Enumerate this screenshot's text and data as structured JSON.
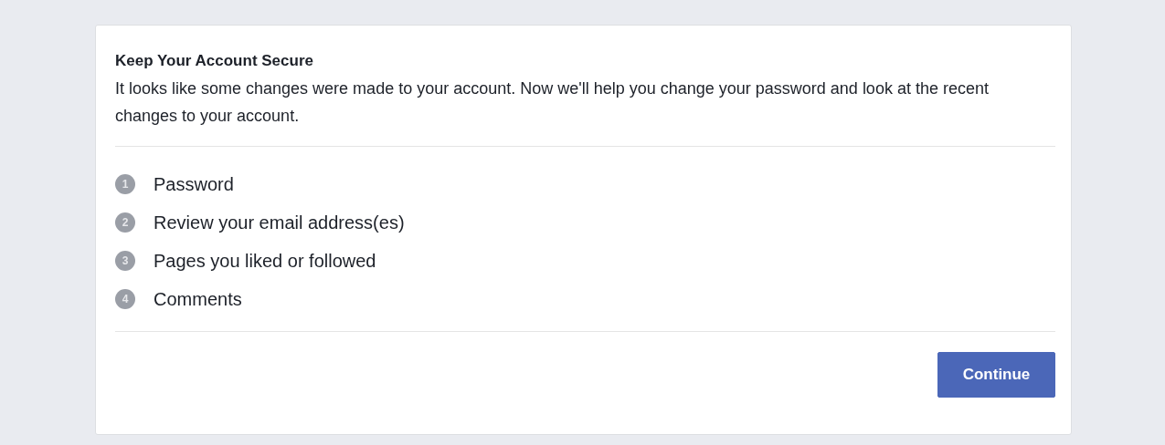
{
  "dialog": {
    "title": "Keep Your Account Secure",
    "message": "It looks like some changes were made to your account. Now we'll help you change your password and look at the recent changes to your account.",
    "steps": [
      {
        "number": "1",
        "label": "Password"
      },
      {
        "number": "2",
        "label": "Review your email address(es)"
      },
      {
        "number": "3",
        "label": "Pages you liked or followed"
      },
      {
        "number": "4",
        "label": "Comments"
      }
    ],
    "button": "Continue"
  }
}
